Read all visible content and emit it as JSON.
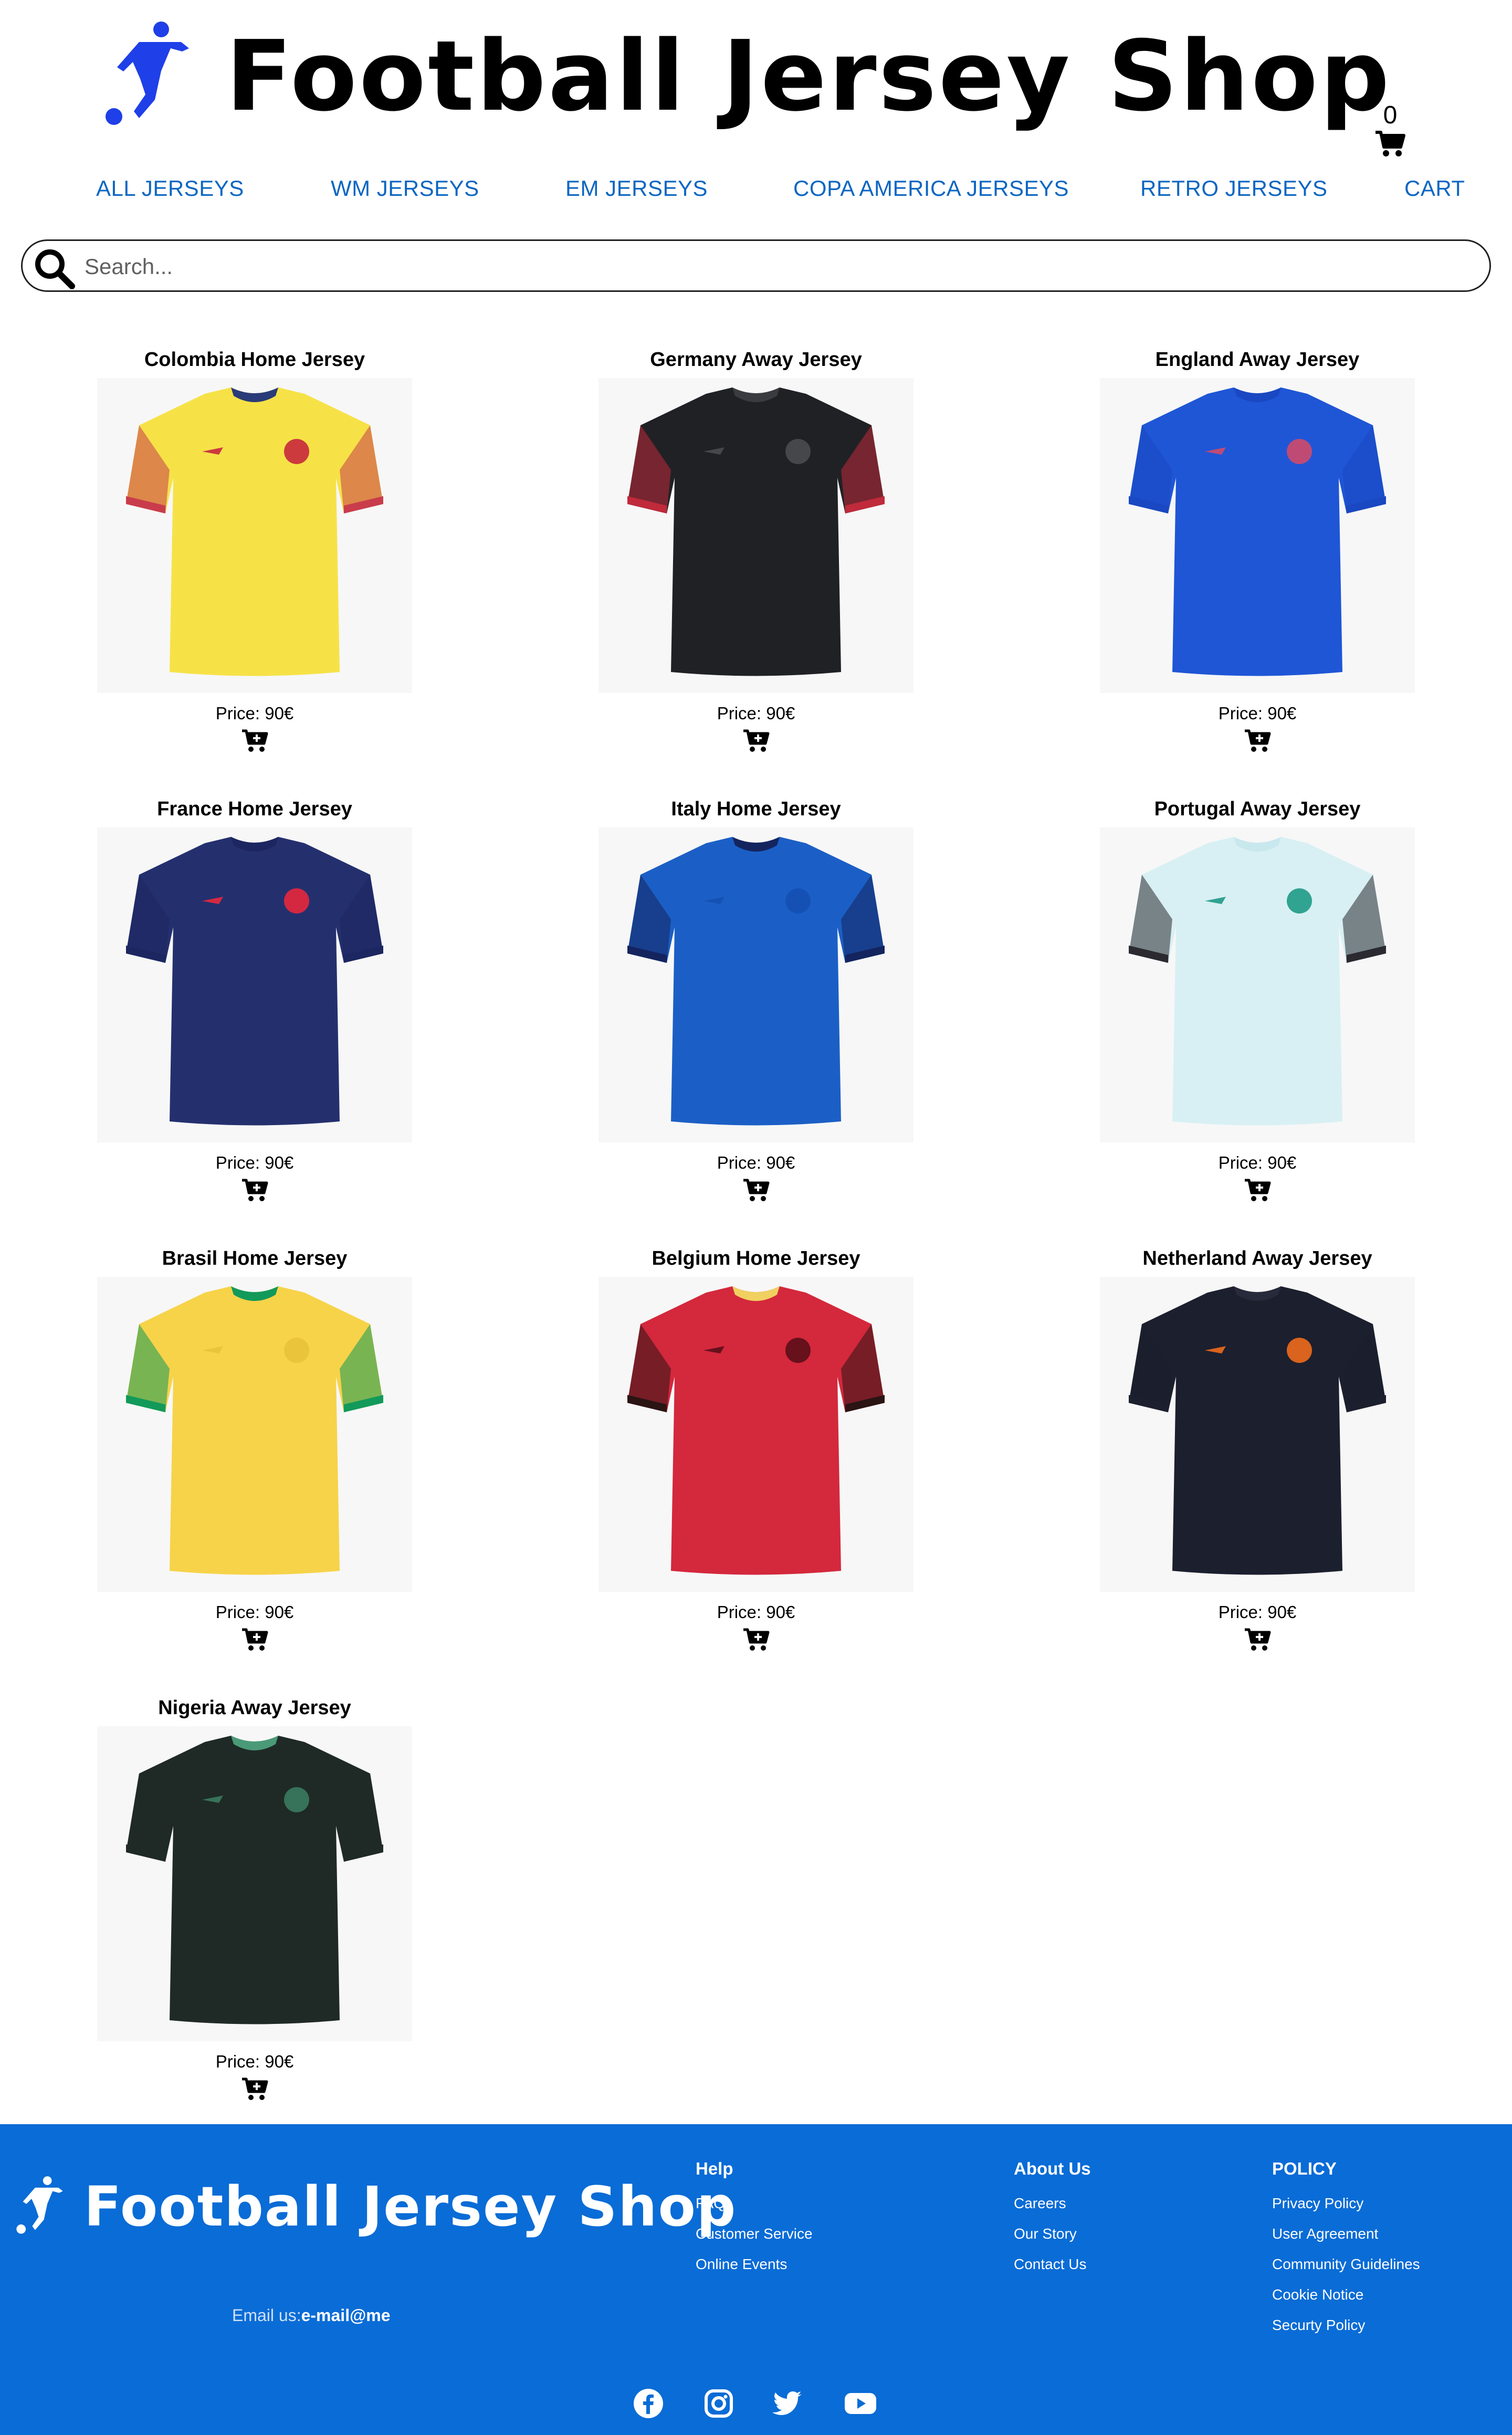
{
  "header": {
    "brand": "Football Jersey Shop",
    "cart_count": "0"
  },
  "nav": {
    "items": [
      "ALL JERSEYS",
      "WM JERSEYS",
      "EM JERSEYS",
      "COPA AMERICA JERSEYS",
      "RETRO JERSEYS",
      "CART"
    ]
  },
  "search": {
    "placeholder": "Search..."
  },
  "products": [
    {
      "title": "Colombia Home Jersey",
      "price": "Price: 90€",
      "body": "#f6e247",
      "sleeve": "#c93c4c",
      "collar": "#2a3b78",
      "accent": "#c8283c"
    },
    {
      "title": "Germany Away Jersey",
      "price": "Price: 90€",
      "body": "#202125",
      "sleeve": "#c02a3a",
      "collar": "#3a3b40",
      "accent": "#4a4b50"
    },
    {
      "title": "England Away Jersey",
      "price": "Price: 90€",
      "body": "#1f56d6",
      "sleeve": "#1a48c2",
      "collar": "#1a48c2",
      "accent": "#d04a6a"
    },
    {
      "title": "France Home Jersey",
      "price": "Price: 90€",
      "body": "#24306e",
      "sleeve": "#1c2660",
      "collar": "#1c2660",
      "accent": "#e8283c"
    },
    {
      "title": "Italy Home Jersey",
      "price": "Price: 90€",
      "body": "#1b5fc6",
      "sleeve": "#14245e",
      "collar": "#14245e",
      "accent": "#1550b2"
    },
    {
      "title": "Portugal Away Jersey",
      "price": "Price: 90€",
      "body": "#d8f0f3",
      "sleeve": "#2a2a30",
      "collar": "#c8e8ee",
      "accent": "#1e9a86"
    },
    {
      "title": "Brasil Home Jersey",
      "price": "Price: 90€",
      "body": "#f7d349",
      "sleeve": "#129a5a",
      "collar": "#129a5a",
      "accent": "#e8c238"
    },
    {
      "title": "Belgium Home Jersey",
      "price": "Price: 90€",
      "body": "#d4283c",
      "sleeve": "#2a1414",
      "collar": "#f0d060",
      "accent": "#5a0e18"
    },
    {
      "title": "Netherland Away Jersey",
      "price": "Price: 90€",
      "body": "#1c1f2e",
      "sleeve": "#1c1f2e",
      "collar": "#262a3a",
      "accent": "#f06a1c"
    },
    {
      "title": "Nigeria Away Jersey",
      "price": "Price: 90€",
      "body": "#1f2a26",
      "sleeve": "#1f2a26",
      "collar": "#4a9a78",
      "accent": "#3a7a60"
    }
  ],
  "footer": {
    "brand": "Football Jersey Shop",
    "email_label": "Email us:",
    "email_value": "e-mail@me",
    "columns": [
      {
        "title": "Help",
        "links": [
          "FAQ",
          "Customer Service",
          "Online Events"
        ]
      },
      {
        "title": "About Us",
        "links": [
          "Careers",
          "Our Story",
          "Contact Us"
        ]
      },
      {
        "title": "POLICY",
        "links": [
          "Privacy Policy",
          "User Agreement",
          "Community Guidelines",
          "Cookie Notice",
          "Securty Policy"
        ]
      }
    ],
    "socials": [
      "facebook-icon",
      "instagram-icon",
      "twitter-icon",
      "youtube-icon"
    ]
  },
  "colors": {
    "brand_blue": "#1f3fe8",
    "nav_link": "#0a66c2",
    "footer_bg": "#0a6cd6"
  }
}
